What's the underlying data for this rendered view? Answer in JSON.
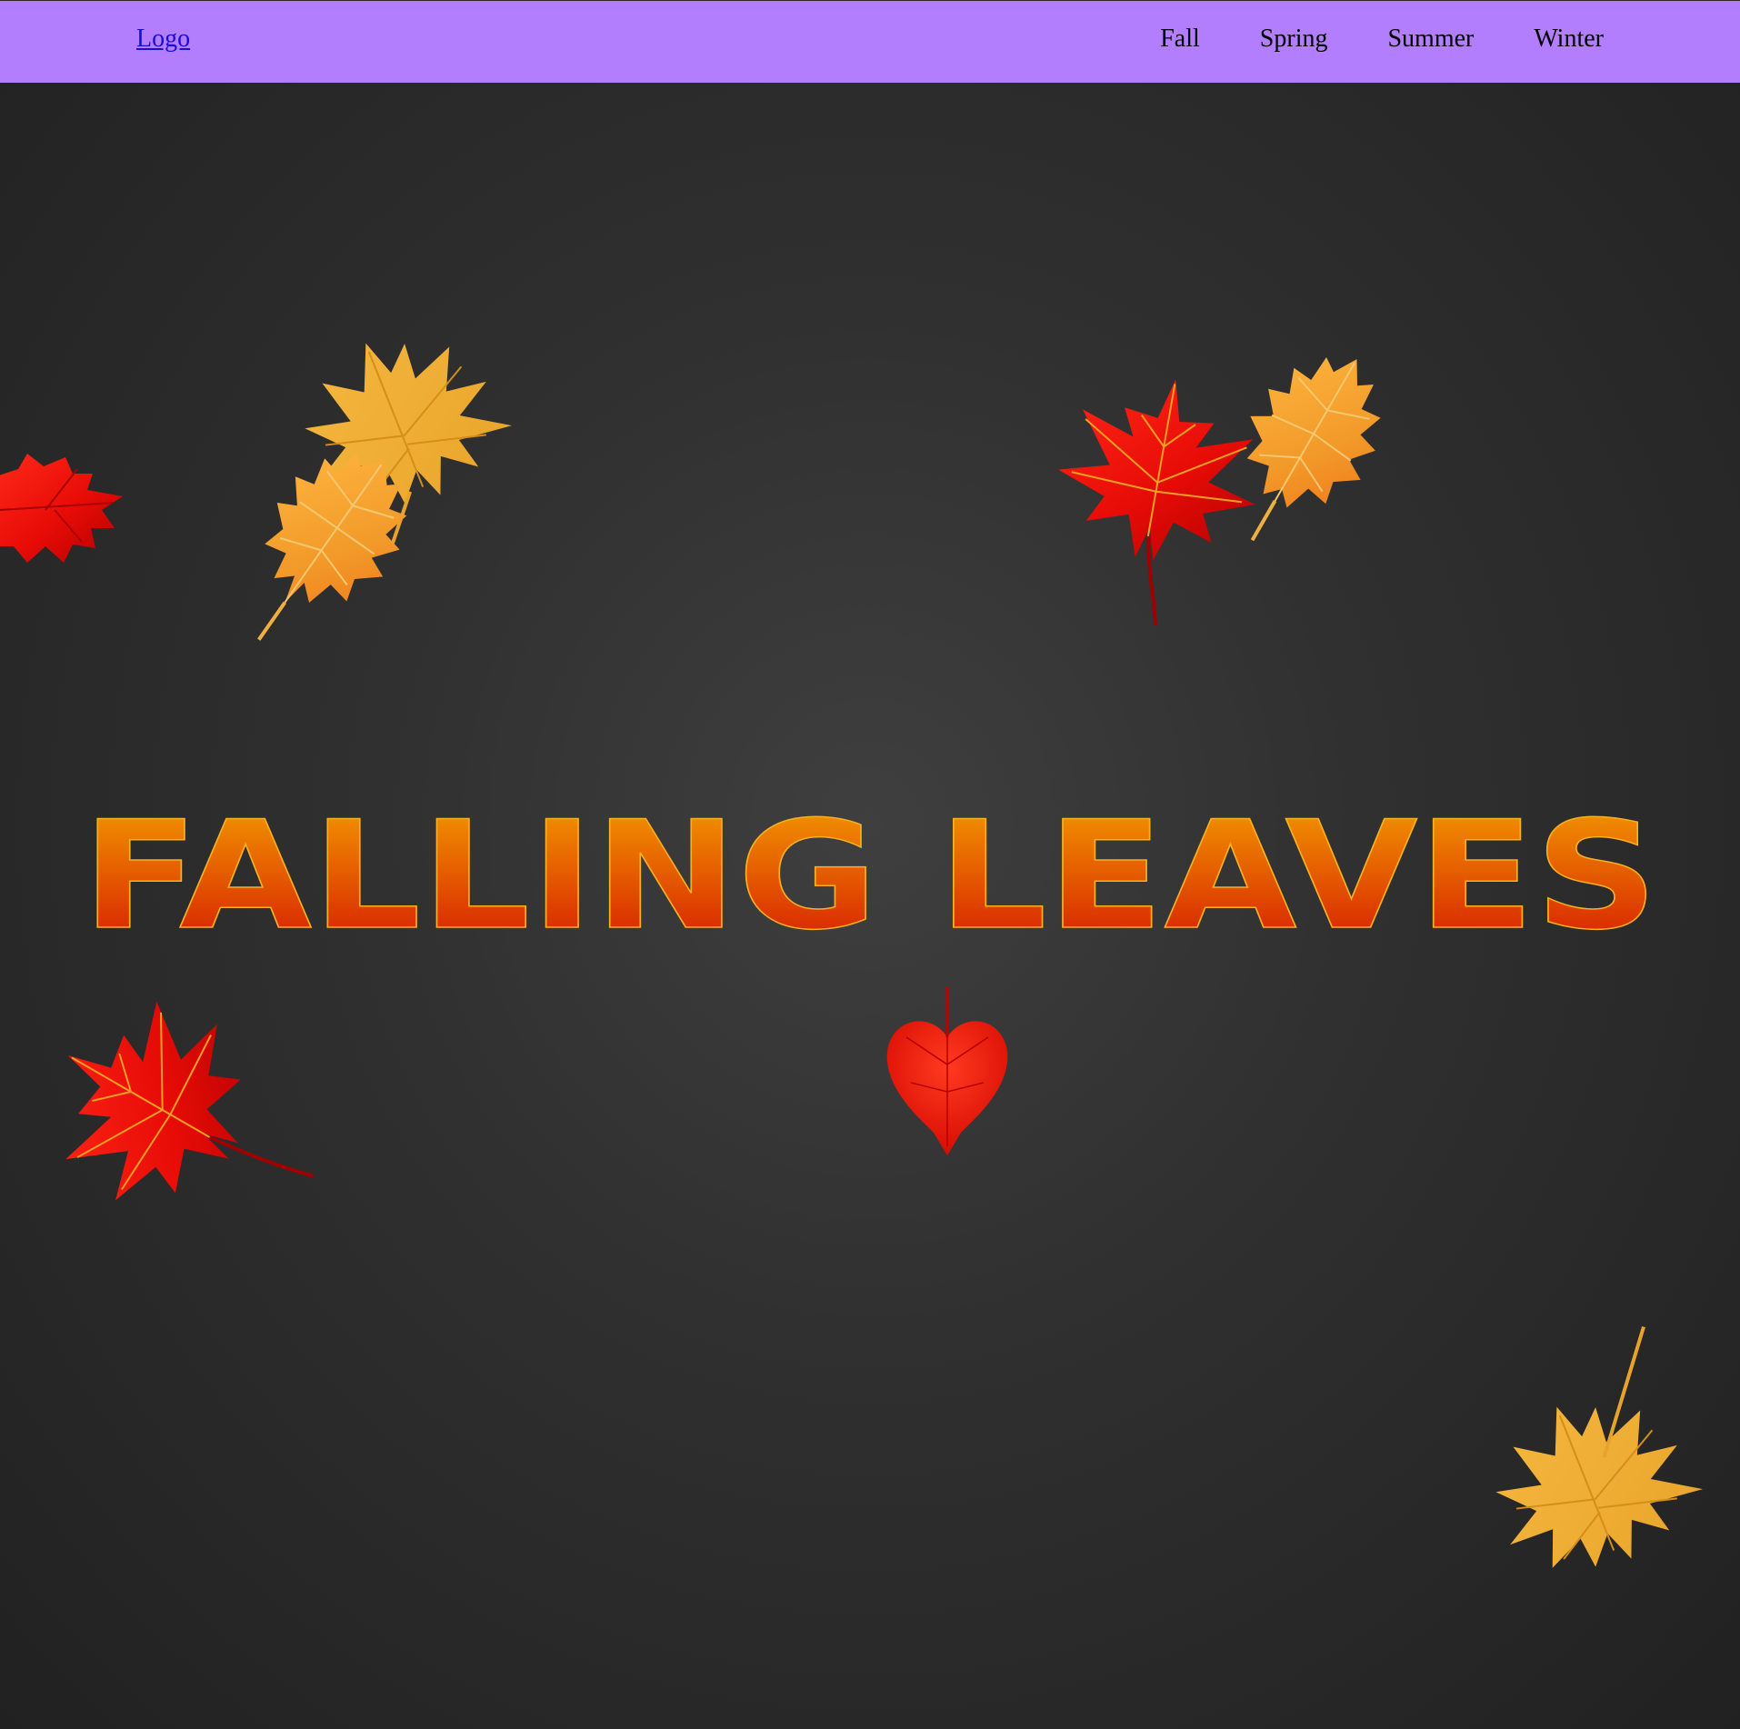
{
  "navbar": {
    "logo": "Logo",
    "links": [
      "Fall",
      "Spring",
      "Summer",
      "Winter"
    ],
    "background": "#b27efe",
    "logo_color": "#1a0dd8"
  },
  "hero": {
    "title": "FALLING LEAVES",
    "title_gradient_top": "#f5a200",
    "title_gradient_bottom": "#d41200",
    "background_center": "#3f3f3f",
    "background_edge": "#212121"
  },
  "leaves": [
    {
      "name": "red-leaf-icon",
      "color": "red"
    },
    {
      "name": "orange-oak-leaf-icon",
      "color": "orange"
    },
    {
      "name": "yellow-maple-leaf-icon",
      "color": "yellow"
    },
    {
      "name": "red-maple-leaf-icon",
      "color": "red"
    },
    {
      "name": "orange-oak-leaf-icon",
      "color": "orange"
    },
    {
      "name": "red-maple-leaf-icon",
      "color": "red"
    },
    {
      "name": "red-heart-leaf-icon",
      "color": "red"
    },
    {
      "name": "yellow-maple-leaf-icon",
      "color": "yellow"
    }
  ]
}
